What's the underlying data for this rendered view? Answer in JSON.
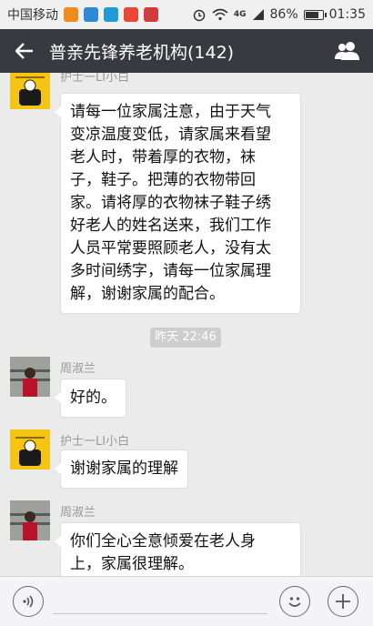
{
  "status_bar": {
    "carrier": "中国移动",
    "network": "4G",
    "battery": "86%",
    "battery_level": 0.86,
    "time": "01:35"
  },
  "header": {
    "title": "普亲先锋养老机构(142)",
    "back_icon": "back-arrow-icon",
    "members_icon": "group-members-icon"
  },
  "messages": [
    {
      "sender": "护士一LI小白",
      "text_lines": [
        "请每一位家属注意，由于天气",
        "变凉温度变低，请家属来看望",
        "老人时，带着厚的衣物，袜",
        "子，鞋子。把薄的衣物带回",
        "家。请将厚的衣物袜子鞋子绣",
        "好老人的姓名送来，我们工作",
        "人员平常要照顾老人，没有太",
        "多时间绣字，请每一位家属理",
        "解，谢谢家属的配合。"
      ]
    },
    {
      "timestamp": "昨天 22:46"
    },
    {
      "sender": "周淑兰",
      "text_lines": [
        "好的。"
      ]
    },
    {
      "sender": "护士一LI小白",
      "text_lines": [
        "谢谢家属的理解"
      ]
    },
    {
      "sender": "周淑兰",
      "text_lines": [
        "你们全心全意倾爱在老人身",
        "上，家属很理解。"
      ]
    }
  ],
  "input_bar": {
    "voice_icon": "voice-icon",
    "emoji_icon": "emoji-icon",
    "add_icon": "add-icon"
  }
}
